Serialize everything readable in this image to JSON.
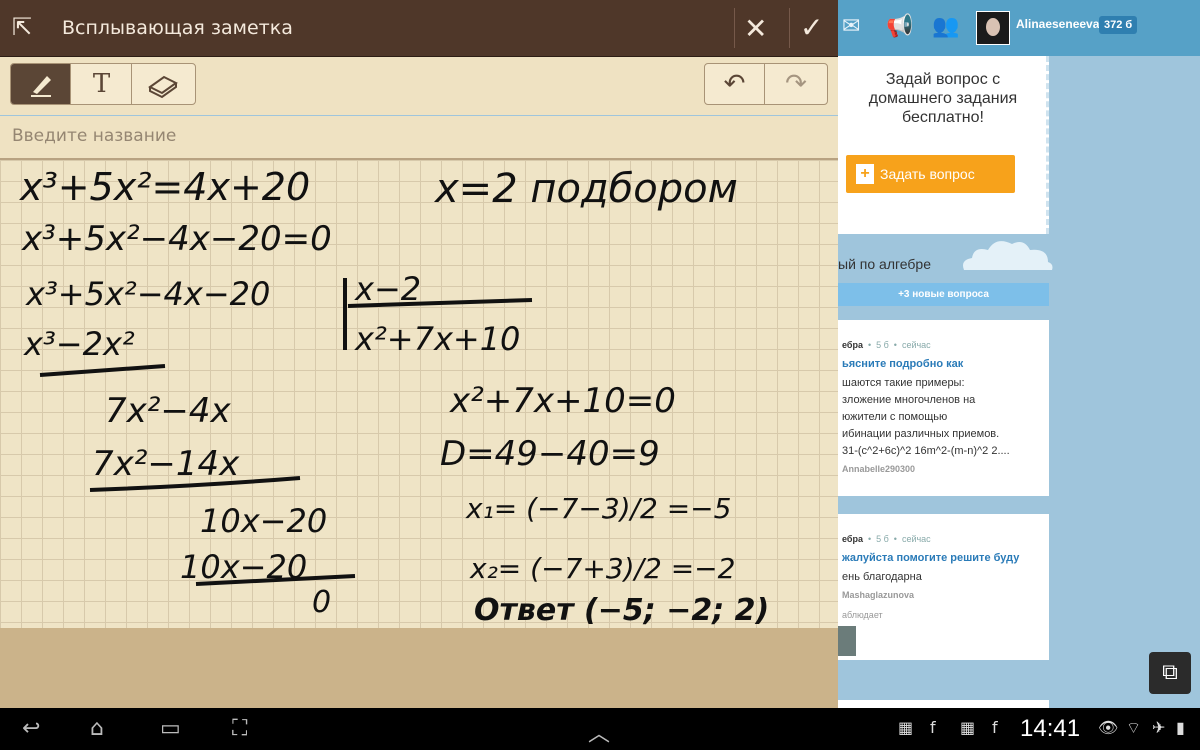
{
  "note": {
    "header": {
      "title": "Всплывающая заметка"
    },
    "title_placeholder": "Введите название",
    "tools": {
      "text_tool_glyph": "T"
    },
    "handwriting": [
      "x³+5x²=4x+20",
      "x=2 подбором",
      "x³+5x²−4x−20=0",
      "x³+5x²−4x−20",
      "x−2",
      "x³−2x²",
      "x²+7x+10",
      "7x²−4x",
      "7x²−14x",
      "10x−20",
      "10x−20",
      "0",
      "x²+7x+10=0",
      "D=49−40=9",
      "x₁= (−7−3)/2 =−5",
      "x₂= (−7+3)/2 =−2",
      "Ответ (−5; −2; 2)"
    ]
  },
  "web": {
    "user": {
      "name": "Alinaeseneeva",
      "points": "372 б"
    },
    "ask": {
      "text": "Задай вопрос с домашнего задания бесплатно!",
      "button": "Задать вопрос"
    },
    "subject": "ый по алгебре",
    "new_questions": "+3 новые вопроса",
    "questions": [
      {
        "subject": "ебра",
        "points": "5 б",
        "time": "сейчас",
        "title": "ьясните подробно как",
        "lines": [
          "шаются такие примеры:",
          "зложение многочленов на",
          "южители с помощью",
          "ибинации различных приемов.",
          "31-(c^2+6c)^2 16m^2-(m-n)^2 2...."
        ],
        "user": "Annabelle290300"
      },
      {
        "subject": "ебра",
        "points": "5 б",
        "time": "сейчас",
        "title": "жалуйста помогите решите буду",
        "lines": [
          "ень благодарна"
        ],
        "user": "Mashaglazunova",
        "status": "аблюдает"
      }
    ]
  },
  "system": {
    "time": "14:41"
  }
}
